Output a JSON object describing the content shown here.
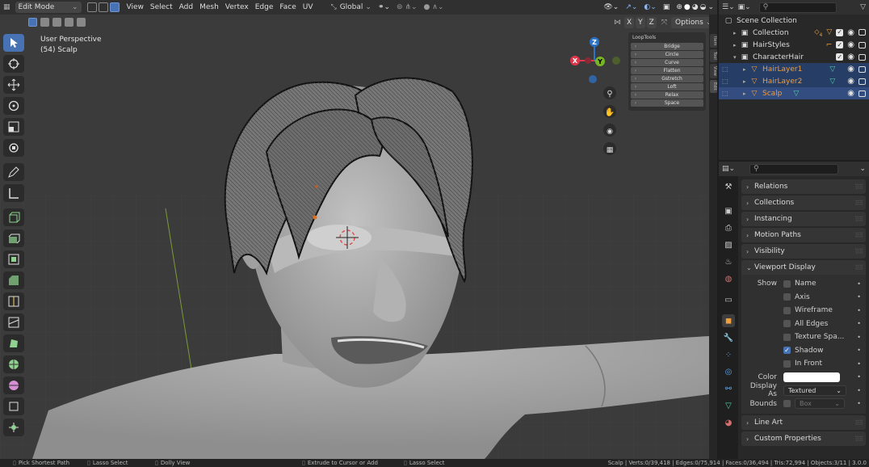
{
  "header": {
    "mode": "Edit Mode",
    "menus": [
      "View",
      "Select",
      "Add",
      "Mesh",
      "Vertex",
      "Edge",
      "Face",
      "UV"
    ],
    "transform_orientation": "Global"
  },
  "viewport": {
    "perspective_label": "User Perspective",
    "object_label": "(54) Scalp",
    "axis_buttons": [
      "X",
      "Y",
      "Z"
    ],
    "options_label": "Options",
    "gizmo": {
      "x": "X",
      "y": "Y",
      "z": "Z"
    },
    "colors": {
      "x": "#e0364b",
      "y": "#79b426",
      "z": "#2d73c8",
      "background": "#3a3a3a",
      "mesh": "#a8a8a8"
    }
  },
  "looptools": {
    "title": "LoopTools",
    "items": [
      "Bridge",
      "Circle",
      "Curve",
      "Flatten",
      "Gstretch",
      "Loft",
      "Relax",
      "Space"
    ]
  },
  "sidebar_tabs": [
    "Item",
    "Tool",
    "View",
    "Edit"
  ],
  "outliner": {
    "title": "Scene Collection",
    "items": [
      {
        "name": "Collection",
        "badge": "4",
        "selected": false
      },
      {
        "name": "HairStyles",
        "badge": "",
        "selected": false
      },
      {
        "name": "CharacterHair",
        "badge": "",
        "selected": false
      },
      {
        "name": "HairLayer1",
        "badge": "",
        "selected": true
      },
      {
        "name": "HairLayer2",
        "badge": "",
        "selected": true
      },
      {
        "name": "Scalp",
        "badge": "",
        "selected": true
      }
    ]
  },
  "properties": {
    "sections_top": [
      "Relations",
      "Collections",
      "Instancing",
      "Motion Paths",
      "Visibility"
    ],
    "viewport_display": {
      "title": "Viewport Display",
      "show_label": "Show",
      "options": [
        {
          "label": "Name",
          "checked": false
        },
        {
          "label": "Axis",
          "checked": false
        },
        {
          "label": "Wireframe",
          "checked": false
        },
        {
          "label": "All Edges",
          "checked": false
        },
        {
          "label": "Texture Spa...",
          "checked": false
        },
        {
          "label": "Shadow",
          "checked": true
        },
        {
          "label": "In Front",
          "checked": false
        }
      ],
      "color_label": "Color",
      "color_value": "#ffffff",
      "display_as_label": "Display As",
      "display_as_value": "Textured",
      "bounds_label": "Bounds",
      "bounds_value": "Box"
    },
    "sections_bottom": [
      "Line Art",
      "Custom Properties"
    ]
  },
  "status": {
    "left1": "Pick Shortest Path",
    "left2": "Lasso Select",
    "left3": "Dolly View",
    "mid1": "Extrude to Cursor or Add",
    "mid2": "Lasso Select",
    "right": "Scalp | Verts:0/39,418 | Edges:0/75,914 | Faces:0/36,494 | Tris:72,994 | Objects:3/11 | 3.0.0"
  }
}
